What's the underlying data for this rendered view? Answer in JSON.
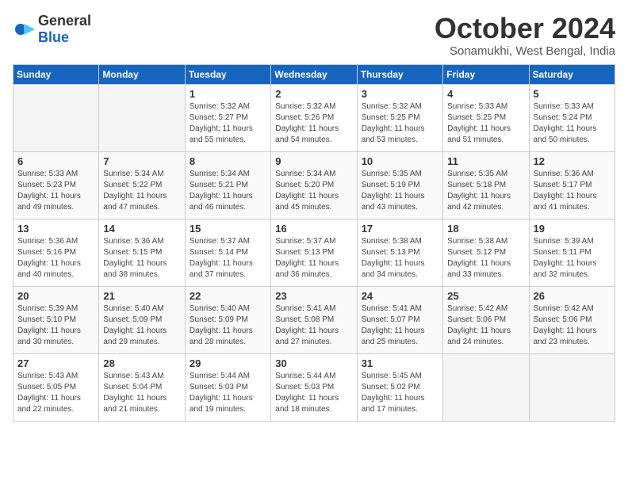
{
  "logo": {
    "text_general": "General",
    "text_blue": "Blue"
  },
  "header": {
    "month_title": "October 2024",
    "subtitle": "Sonamukhi, West Bengal, India"
  },
  "days_of_week": [
    "Sunday",
    "Monday",
    "Tuesday",
    "Wednesday",
    "Thursday",
    "Friday",
    "Saturday"
  ],
  "weeks": [
    [
      {
        "num": "",
        "info": ""
      },
      {
        "num": "",
        "info": ""
      },
      {
        "num": "1",
        "info": "Sunrise: 5:32 AM\nSunset: 5:27 PM\nDaylight: 11 hours and 55 minutes."
      },
      {
        "num": "2",
        "info": "Sunrise: 5:32 AM\nSunset: 5:26 PM\nDaylight: 11 hours and 54 minutes."
      },
      {
        "num": "3",
        "info": "Sunrise: 5:32 AM\nSunset: 5:25 PM\nDaylight: 11 hours and 53 minutes."
      },
      {
        "num": "4",
        "info": "Sunrise: 5:33 AM\nSunset: 5:25 PM\nDaylight: 11 hours and 51 minutes."
      },
      {
        "num": "5",
        "info": "Sunrise: 5:33 AM\nSunset: 5:24 PM\nDaylight: 11 hours and 50 minutes."
      }
    ],
    [
      {
        "num": "6",
        "info": "Sunrise: 5:33 AM\nSunset: 5:23 PM\nDaylight: 11 hours and 49 minutes."
      },
      {
        "num": "7",
        "info": "Sunrise: 5:34 AM\nSunset: 5:22 PM\nDaylight: 11 hours and 47 minutes."
      },
      {
        "num": "8",
        "info": "Sunrise: 5:34 AM\nSunset: 5:21 PM\nDaylight: 11 hours and 46 minutes."
      },
      {
        "num": "9",
        "info": "Sunrise: 5:34 AM\nSunset: 5:20 PM\nDaylight: 11 hours and 45 minutes."
      },
      {
        "num": "10",
        "info": "Sunrise: 5:35 AM\nSunset: 5:19 PM\nDaylight: 11 hours and 43 minutes."
      },
      {
        "num": "11",
        "info": "Sunrise: 5:35 AM\nSunset: 5:18 PM\nDaylight: 11 hours and 42 minutes."
      },
      {
        "num": "12",
        "info": "Sunrise: 5:36 AM\nSunset: 5:17 PM\nDaylight: 11 hours and 41 minutes."
      }
    ],
    [
      {
        "num": "13",
        "info": "Sunrise: 5:36 AM\nSunset: 5:16 PM\nDaylight: 11 hours and 40 minutes."
      },
      {
        "num": "14",
        "info": "Sunrise: 5:36 AM\nSunset: 5:15 PM\nDaylight: 11 hours and 38 minutes."
      },
      {
        "num": "15",
        "info": "Sunrise: 5:37 AM\nSunset: 5:14 PM\nDaylight: 11 hours and 37 minutes."
      },
      {
        "num": "16",
        "info": "Sunrise: 5:37 AM\nSunset: 5:13 PM\nDaylight: 11 hours and 36 minutes."
      },
      {
        "num": "17",
        "info": "Sunrise: 5:38 AM\nSunset: 5:13 PM\nDaylight: 11 hours and 34 minutes."
      },
      {
        "num": "18",
        "info": "Sunrise: 5:38 AM\nSunset: 5:12 PM\nDaylight: 11 hours and 33 minutes."
      },
      {
        "num": "19",
        "info": "Sunrise: 5:39 AM\nSunset: 5:11 PM\nDaylight: 11 hours and 32 minutes."
      }
    ],
    [
      {
        "num": "20",
        "info": "Sunrise: 5:39 AM\nSunset: 5:10 PM\nDaylight: 11 hours and 30 minutes."
      },
      {
        "num": "21",
        "info": "Sunrise: 5:40 AM\nSunset: 5:09 PM\nDaylight: 11 hours and 29 minutes."
      },
      {
        "num": "22",
        "info": "Sunrise: 5:40 AM\nSunset: 5:09 PM\nDaylight: 11 hours and 28 minutes."
      },
      {
        "num": "23",
        "info": "Sunrise: 5:41 AM\nSunset: 5:08 PM\nDaylight: 11 hours and 27 minutes."
      },
      {
        "num": "24",
        "info": "Sunrise: 5:41 AM\nSunset: 5:07 PM\nDaylight: 11 hours and 25 minutes."
      },
      {
        "num": "25",
        "info": "Sunrise: 5:42 AM\nSunset: 5:06 PM\nDaylight: 11 hours and 24 minutes."
      },
      {
        "num": "26",
        "info": "Sunrise: 5:42 AM\nSunset: 5:06 PM\nDaylight: 11 hours and 23 minutes."
      }
    ],
    [
      {
        "num": "27",
        "info": "Sunrise: 5:43 AM\nSunset: 5:05 PM\nDaylight: 11 hours and 22 minutes."
      },
      {
        "num": "28",
        "info": "Sunrise: 5:43 AM\nSunset: 5:04 PM\nDaylight: 11 hours and 21 minutes."
      },
      {
        "num": "29",
        "info": "Sunrise: 5:44 AM\nSunset: 5:03 PM\nDaylight: 11 hours and 19 minutes."
      },
      {
        "num": "30",
        "info": "Sunrise: 5:44 AM\nSunset: 5:03 PM\nDaylight: 11 hours and 18 minutes."
      },
      {
        "num": "31",
        "info": "Sunrise: 5:45 AM\nSunset: 5:02 PM\nDaylight: 11 hours and 17 minutes."
      },
      {
        "num": "",
        "info": ""
      },
      {
        "num": "",
        "info": ""
      }
    ]
  ]
}
